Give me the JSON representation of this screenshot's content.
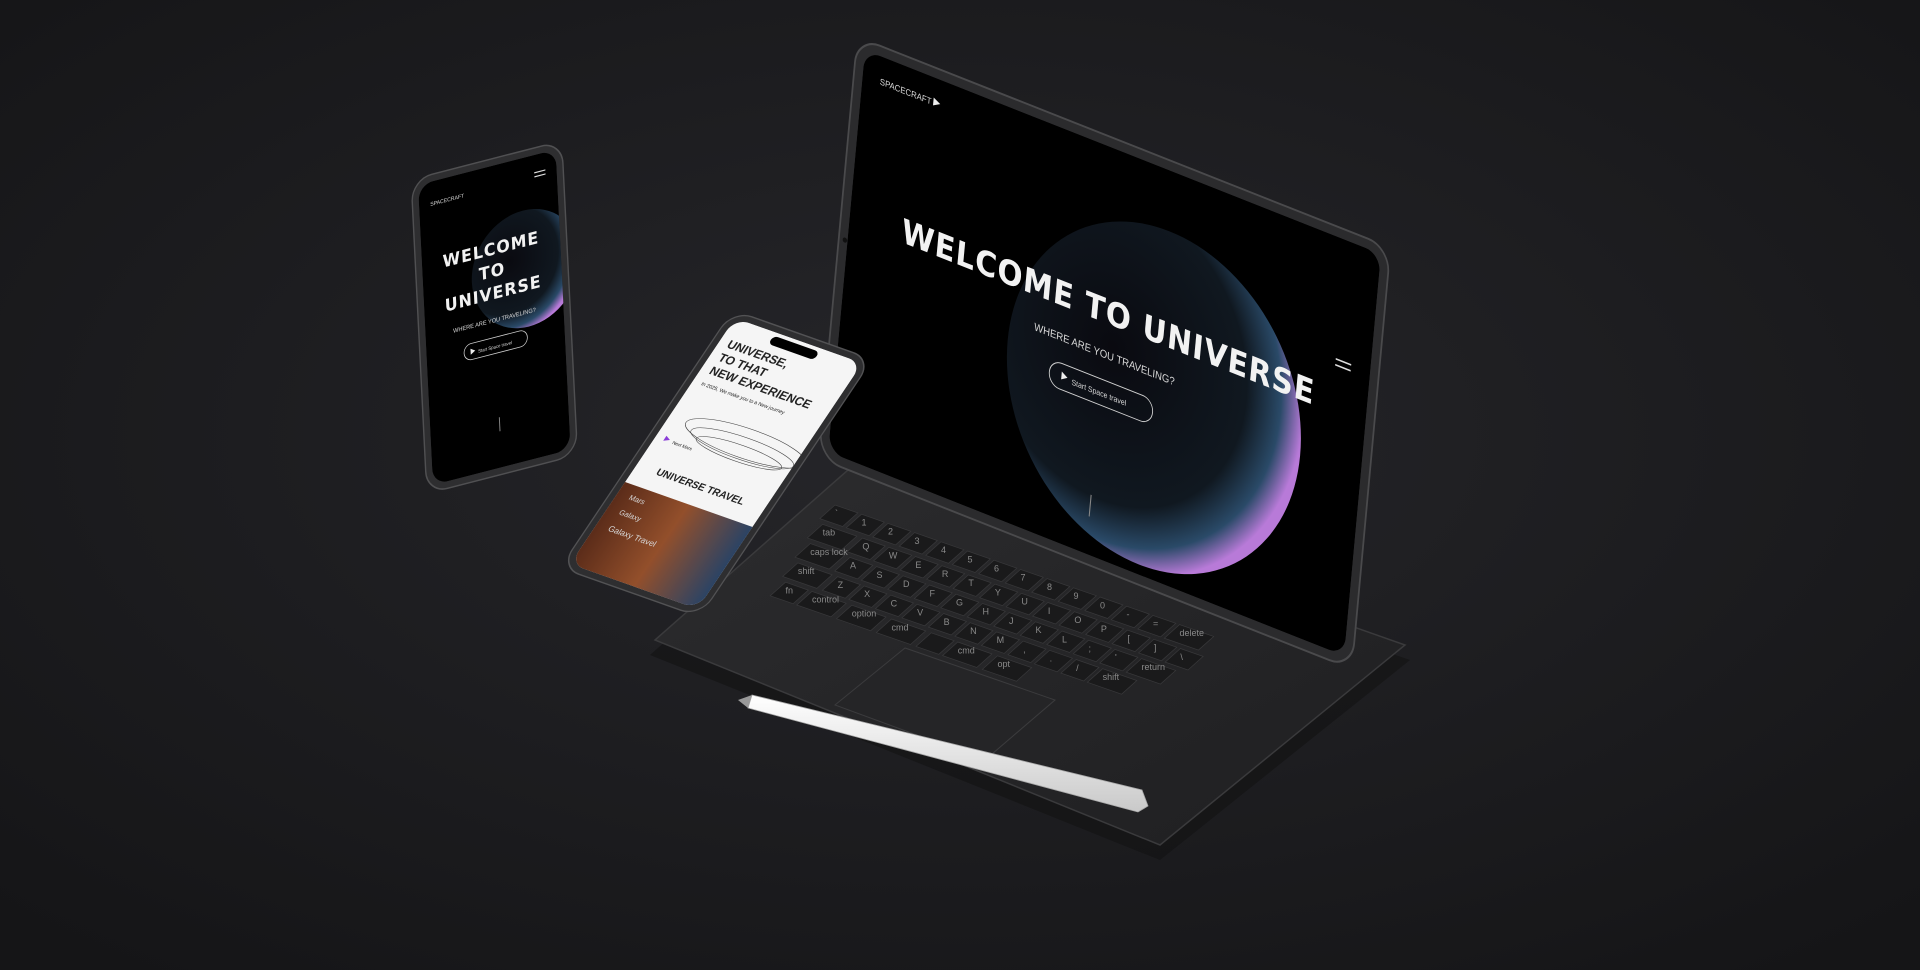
{
  "tablet": {
    "logo": "SPACECRAFT",
    "headline": "WELCOME TO UNIVERSE",
    "subheadline": "WHERE ARE YOU TRAVELING?",
    "cta_label": "Start Space travel"
  },
  "phone_left": {
    "logo": "SPACECRAFT",
    "headline_line1": "WELCOME",
    "headline_line2": "TO",
    "headline_line3": "UNIVERSE",
    "subheadline": "WHERE ARE YOU TRAVELING?",
    "cta_label": "Start Space travel"
  },
  "phone_right": {
    "headline_line1": "UNIVERSE,",
    "headline_line2": "TO THAT",
    "headline_line3": "NEW EXPERIENCE",
    "intro": "In 2025, We make you to a New journey",
    "link_label": "Next Mars",
    "section_title": "UNIVERSE TRAVEL",
    "list_item_1": "Mars",
    "list_item_2": "Galaxy",
    "list_item_3": "Galaxy Travel"
  },
  "keyboard": {
    "row1": [
      "`",
      "1",
      "2",
      "3",
      "4",
      "5",
      "6",
      "7",
      "8",
      "9",
      "0",
      "-",
      "=",
      "delete"
    ],
    "row2": [
      "tab",
      "Q",
      "W",
      "E",
      "R",
      "T",
      "Y",
      "U",
      "I",
      "O",
      "P",
      "[",
      "]",
      "\\"
    ],
    "row3": [
      "caps lock",
      "A",
      "S",
      "D",
      "F",
      "G",
      "H",
      "J",
      "K",
      "L",
      ";",
      "'",
      "return"
    ],
    "row4": [
      "shift",
      "Z",
      "X",
      "C",
      "V",
      "B",
      "N",
      "M",
      ",",
      ".",
      "/",
      "shift"
    ],
    "row5": [
      "fn",
      "control",
      "option",
      "cmd",
      "",
      "cmd",
      "opt"
    ]
  },
  "colors": {
    "background": "#1c1c1e",
    "screen": "#000000",
    "device_frame": "#2b2b2d",
    "pencil": "#e8e8e8",
    "planet_glow": "#b87ad8"
  }
}
